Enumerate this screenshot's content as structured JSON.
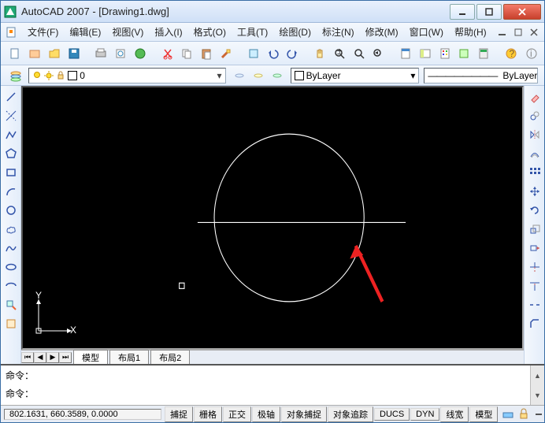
{
  "title": "AutoCAD 2007 - [Drawing1.dwg]",
  "menu": {
    "items": [
      "文件(F)",
      "编辑(E)",
      "视图(V)",
      "插入(I)",
      "格式(O)",
      "工具(T)",
      "绘图(D)",
      "标注(N)",
      "修改(M)",
      "窗口(W)",
      "帮助(H)"
    ]
  },
  "layer": {
    "current": "0",
    "icons": {
      "bulb": "lightbulb-icon",
      "sun": "sun-icon",
      "lock": "lock-icon",
      "square": "layer-color-icon"
    }
  },
  "properties": {
    "color_label": "ByLayer",
    "linetype_sample": "————————",
    "linetype_label": "ByLayer"
  },
  "tabs": {
    "model": "模型",
    "layout1": "布局1",
    "layout2": "布局2"
  },
  "command": {
    "prompt": "命令："
  },
  "status": {
    "coords": "802.1631, 660.3589, 0.0000",
    "buttons": [
      "捕捉",
      "栅格",
      "正交",
      "极轴",
      "对象捕捉",
      "对象追踪",
      "DUCS",
      "DYN",
      "线宽",
      "模型"
    ]
  },
  "ucs": {
    "x": "X",
    "y": "Y"
  },
  "chart_data": null
}
